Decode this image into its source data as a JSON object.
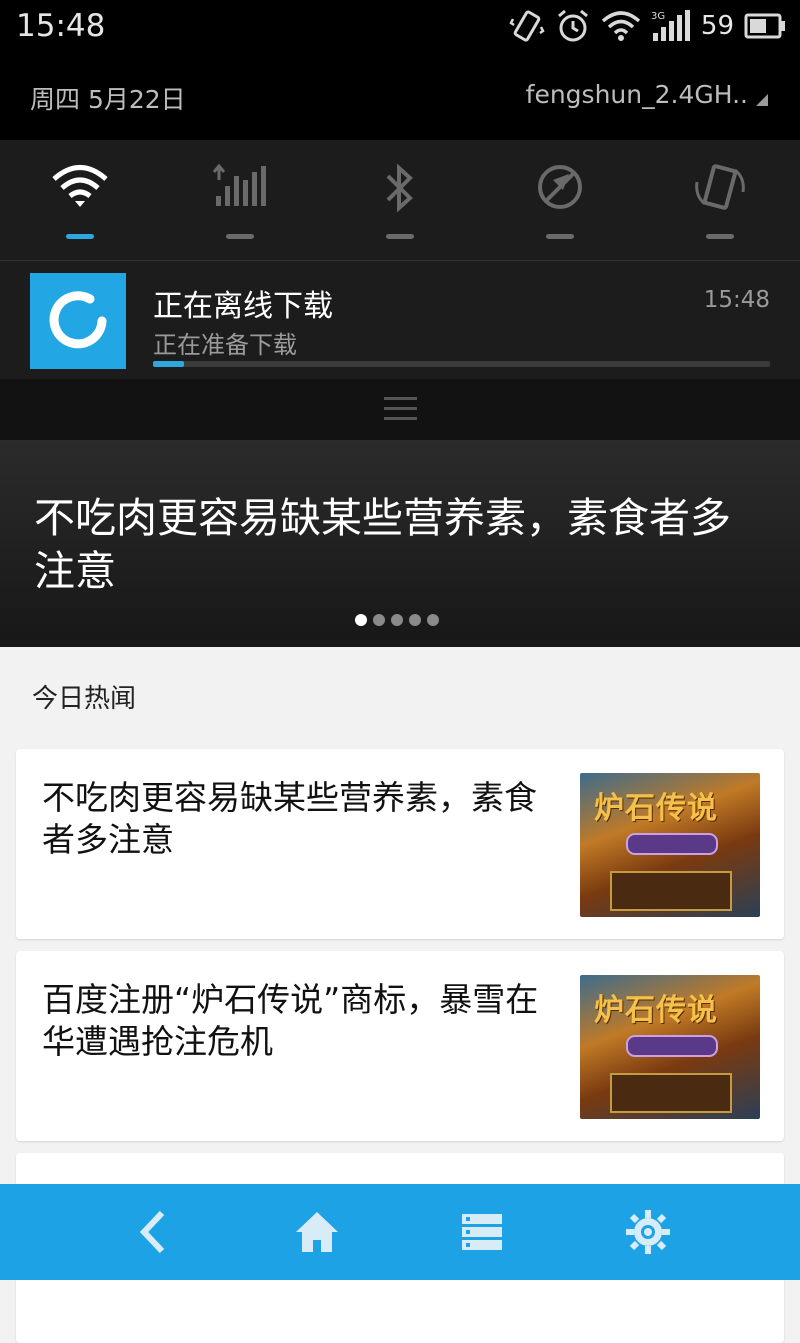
{
  "status_bar": {
    "time": "15:48",
    "battery": "59",
    "network": "3G",
    "icons": [
      "vibrate-icon",
      "alarm-icon",
      "wifi-icon",
      "cell-signal-icon",
      "battery-icon"
    ]
  },
  "shade_header": {
    "date": "周四  5月22日",
    "wifi_name": "fengshun_2.4GH.."
  },
  "quick_toggles": [
    {
      "name": "wifi-icon",
      "on": true
    },
    {
      "name": "mobile-data-icon",
      "on": false
    },
    {
      "name": "bluetooth-icon",
      "on": false
    },
    {
      "name": "gps-location-icon",
      "on": false
    },
    {
      "name": "auto-rotate-icon",
      "on": false
    }
  ],
  "notification": {
    "title": "正在离线下载",
    "subtitle": "正在准备下载",
    "time": "15:48",
    "progress": 0.05,
    "accent": "#2ea7e0"
  },
  "banner": {
    "title": "不吃肉更容易缺某些营养素，素食者多注意",
    "page_count": 5,
    "active_page": 0
  },
  "news": {
    "section_title": "今日热闻",
    "items": [
      {
        "title": "不吃肉更容易缺某些营养素，素食者多注意",
        "thumb_text": "炉石传说"
      },
      {
        "title": "百度注册“炉石传说”商标，暴雪在华遭遇抢注危机",
        "thumb_text": "炉石传说"
      }
    ]
  },
  "nav_bar": {
    "color": "#1ea2e6",
    "buttons": [
      "back-icon",
      "home-icon",
      "list-icon",
      "settings-gear-icon"
    ]
  }
}
